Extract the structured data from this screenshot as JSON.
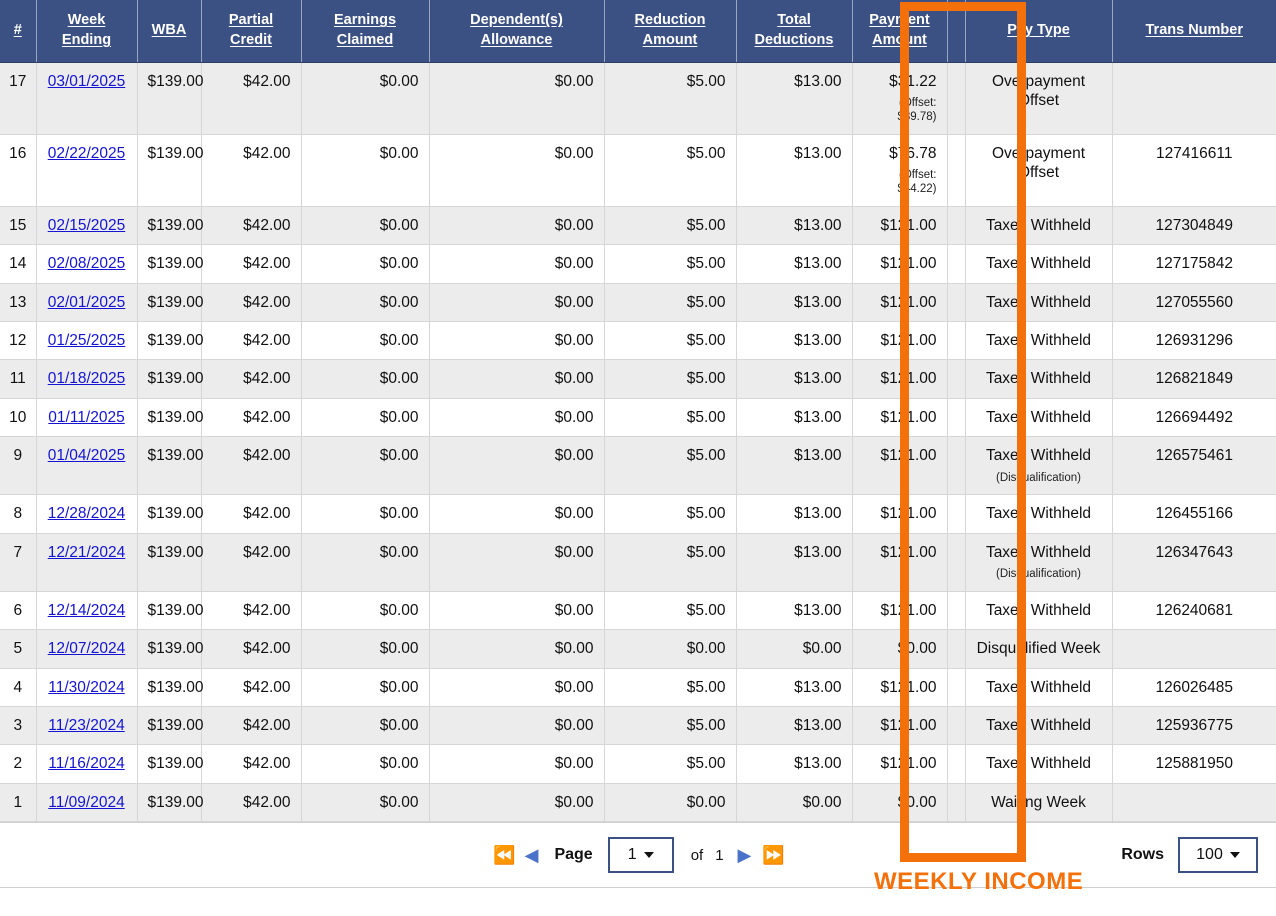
{
  "table": {
    "columns": [
      {
        "key": "idx",
        "label": "#",
        "underline": true
      },
      {
        "key": "week_ending",
        "label": "Week Ending",
        "underline": true
      },
      {
        "key": "wba",
        "label": "WBA",
        "underline": true
      },
      {
        "key": "partial_credit",
        "label": "Partial Credit",
        "underline": true
      },
      {
        "key": "earnings_claimed",
        "label": "Earnings Claimed",
        "underline": true
      },
      {
        "key": "dependents_allowance",
        "label": "Dependent(s) Allowance",
        "underline": true
      },
      {
        "key": "reduction_amount",
        "label": "Reduction Amount",
        "underline": true
      },
      {
        "key": "total_deductions",
        "label": "Total Deductions",
        "underline": true
      },
      {
        "key": "payment_amount",
        "label": "Payment Amount",
        "underline": true
      },
      {
        "key": "spacer",
        "label": "",
        "underline": false
      },
      {
        "key": "pay_type",
        "label": "Pay Type",
        "underline": true
      },
      {
        "key": "trans_number",
        "label": "Trans Number",
        "underline": true
      }
    ],
    "rows": [
      {
        "idx": "17",
        "week_ending": "03/01/2025",
        "wba": "$139.00",
        "partial_credit": "$42.00",
        "earnings_claimed": "$0.00",
        "dependents_allowance": "$0.00",
        "reduction_amount": "$5.00",
        "total_deductions": "$13.00",
        "payment_amount": "$31.22",
        "payment_note": "(Offset: $89.78)",
        "pay_type": "Overpayment Offset",
        "pay_type_note": "",
        "trans_number": ""
      },
      {
        "idx": "16",
        "week_ending": "02/22/2025",
        "wba": "$139.00",
        "partial_credit": "$42.00",
        "earnings_claimed": "$0.00",
        "dependents_allowance": "$0.00",
        "reduction_amount": "$5.00",
        "total_deductions": "$13.00",
        "payment_amount": "$76.78",
        "payment_note": "(Offset: $44.22)",
        "pay_type": "Overpayment Offset",
        "pay_type_note": "",
        "trans_number": "127416611"
      },
      {
        "idx": "15",
        "week_ending": "02/15/2025",
        "wba": "$139.00",
        "partial_credit": "$42.00",
        "earnings_claimed": "$0.00",
        "dependents_allowance": "$0.00",
        "reduction_amount": "$5.00",
        "total_deductions": "$13.00",
        "payment_amount": "$121.00",
        "payment_note": "",
        "pay_type": "Taxes Withheld",
        "pay_type_note": "",
        "trans_number": "127304849"
      },
      {
        "idx": "14",
        "week_ending": "02/08/2025",
        "wba": "$139.00",
        "partial_credit": "$42.00",
        "earnings_claimed": "$0.00",
        "dependents_allowance": "$0.00",
        "reduction_amount": "$5.00",
        "total_deductions": "$13.00",
        "payment_amount": "$121.00",
        "payment_note": "",
        "pay_type": "Taxes Withheld",
        "pay_type_note": "",
        "trans_number": "127175842"
      },
      {
        "idx": "13",
        "week_ending": "02/01/2025",
        "wba": "$139.00",
        "partial_credit": "$42.00",
        "earnings_claimed": "$0.00",
        "dependents_allowance": "$0.00",
        "reduction_amount": "$5.00",
        "total_deductions": "$13.00",
        "payment_amount": "$121.00",
        "payment_note": "",
        "pay_type": "Taxes Withheld",
        "pay_type_note": "",
        "trans_number": "127055560"
      },
      {
        "idx": "12",
        "week_ending": "01/25/2025",
        "wba": "$139.00",
        "partial_credit": "$42.00",
        "earnings_claimed": "$0.00",
        "dependents_allowance": "$0.00",
        "reduction_amount": "$5.00",
        "total_deductions": "$13.00",
        "payment_amount": "$121.00",
        "payment_note": "",
        "pay_type": "Taxes Withheld",
        "pay_type_note": "",
        "trans_number": "126931296"
      },
      {
        "idx": "11",
        "week_ending": "01/18/2025",
        "wba": "$139.00",
        "partial_credit": "$42.00",
        "earnings_claimed": "$0.00",
        "dependents_allowance": "$0.00",
        "reduction_amount": "$5.00",
        "total_deductions": "$13.00",
        "payment_amount": "$121.00",
        "payment_note": "",
        "pay_type": "Taxes Withheld",
        "pay_type_note": "",
        "trans_number": "126821849"
      },
      {
        "idx": "10",
        "week_ending": "01/11/2025",
        "wba": "$139.00",
        "partial_credit": "$42.00",
        "earnings_claimed": "$0.00",
        "dependents_allowance": "$0.00",
        "reduction_amount": "$5.00",
        "total_deductions": "$13.00",
        "payment_amount": "$121.00",
        "payment_note": "",
        "pay_type": "Taxes Withheld",
        "pay_type_note": "",
        "trans_number": "126694492"
      },
      {
        "idx": "9",
        "week_ending": "01/04/2025",
        "wba": "$139.00",
        "partial_credit": "$42.00",
        "earnings_claimed": "$0.00",
        "dependents_allowance": "$0.00",
        "reduction_amount": "$5.00",
        "total_deductions": "$13.00",
        "payment_amount": "$121.00",
        "payment_note": "",
        "pay_type": "Taxes Withheld",
        "pay_type_note": "(Disqualification)",
        "trans_number": "126575461"
      },
      {
        "idx": "8",
        "week_ending": "12/28/2024",
        "wba": "$139.00",
        "partial_credit": "$42.00",
        "earnings_claimed": "$0.00",
        "dependents_allowance": "$0.00",
        "reduction_amount": "$5.00",
        "total_deductions": "$13.00",
        "payment_amount": "$121.00",
        "payment_note": "",
        "pay_type": "Taxes Withheld",
        "pay_type_note": "",
        "trans_number": "126455166"
      },
      {
        "idx": "7",
        "week_ending": "12/21/2024",
        "wba": "$139.00",
        "partial_credit": "$42.00",
        "earnings_claimed": "$0.00",
        "dependents_allowance": "$0.00",
        "reduction_amount": "$5.00",
        "total_deductions": "$13.00",
        "payment_amount": "$121.00",
        "payment_note": "",
        "pay_type": "Taxes Withheld",
        "pay_type_note": "(Disqualification)",
        "trans_number": "126347643"
      },
      {
        "idx": "6",
        "week_ending": "12/14/2024",
        "wba": "$139.00",
        "partial_credit": "$42.00",
        "earnings_claimed": "$0.00",
        "dependents_allowance": "$0.00",
        "reduction_amount": "$5.00",
        "total_deductions": "$13.00",
        "payment_amount": "$121.00",
        "payment_note": "",
        "pay_type": "Taxes Withheld",
        "pay_type_note": "",
        "trans_number": "126240681"
      },
      {
        "idx": "5",
        "week_ending": "12/07/2024",
        "wba": "$139.00",
        "partial_credit": "$42.00",
        "earnings_claimed": "$0.00",
        "dependents_allowance": "$0.00",
        "reduction_amount": "$0.00",
        "total_deductions": "$0.00",
        "payment_amount": "$0.00",
        "payment_note": "",
        "pay_type": "Disqualified Week",
        "pay_type_note": "",
        "trans_number": ""
      },
      {
        "idx": "4",
        "week_ending": "11/30/2024",
        "wba": "$139.00",
        "partial_credit": "$42.00",
        "earnings_claimed": "$0.00",
        "dependents_allowance": "$0.00",
        "reduction_amount": "$5.00",
        "total_deductions": "$13.00",
        "payment_amount": "$121.00",
        "payment_note": "",
        "pay_type": "Taxes Withheld",
        "pay_type_note": "",
        "trans_number": "126026485"
      },
      {
        "idx": "3",
        "week_ending": "11/23/2024",
        "wba": "$139.00",
        "partial_credit": "$42.00",
        "earnings_claimed": "$0.00",
        "dependents_allowance": "$0.00",
        "reduction_amount": "$5.00",
        "total_deductions": "$13.00",
        "payment_amount": "$121.00",
        "payment_note": "",
        "pay_type": "Taxes Withheld",
        "pay_type_note": "",
        "trans_number": "125936775"
      },
      {
        "idx": "2",
        "week_ending": "11/16/2024",
        "wba": "$139.00",
        "partial_credit": "$42.00",
        "earnings_claimed": "$0.00",
        "dependents_allowance": "$0.00",
        "reduction_amount": "$5.00",
        "total_deductions": "$13.00",
        "payment_amount": "$121.00",
        "payment_note": "",
        "pay_type": "Taxes Withheld",
        "pay_type_note": "",
        "trans_number": "125881950"
      },
      {
        "idx": "1",
        "week_ending": "11/09/2024",
        "wba": "$139.00",
        "partial_credit": "$42.00",
        "earnings_claimed": "$0.00",
        "dependents_allowance": "$0.00",
        "reduction_amount": "$0.00",
        "total_deductions": "$0.00",
        "payment_amount": "$0.00",
        "payment_note": "",
        "pay_type": "Waiting Week",
        "pay_type_note": "",
        "trans_number": ""
      }
    ]
  },
  "footer": {
    "first_icon": "first-page-icon",
    "prev_icon": "previous-page-icon",
    "next_icon": "next-page-icon",
    "last_icon": "last-page-icon",
    "page_label": "Page",
    "page_value": "1",
    "of_label": "of",
    "total_pages": "1",
    "rows_label": "Rows",
    "rows_value": "100"
  },
  "annotation": {
    "text": "WEEKLY INCOME",
    "color": "#F4700A"
  },
  "highlight": {
    "target_column": "Payment Amount",
    "color": "#F4700A"
  },
  "colors": {
    "header_background": "#3b5083",
    "header_text": "#ffffff",
    "row_alt_background": "#ececec",
    "row_background": "#ffffff",
    "link": "#1414d2",
    "accent_orange": "#F4700A"
  }
}
